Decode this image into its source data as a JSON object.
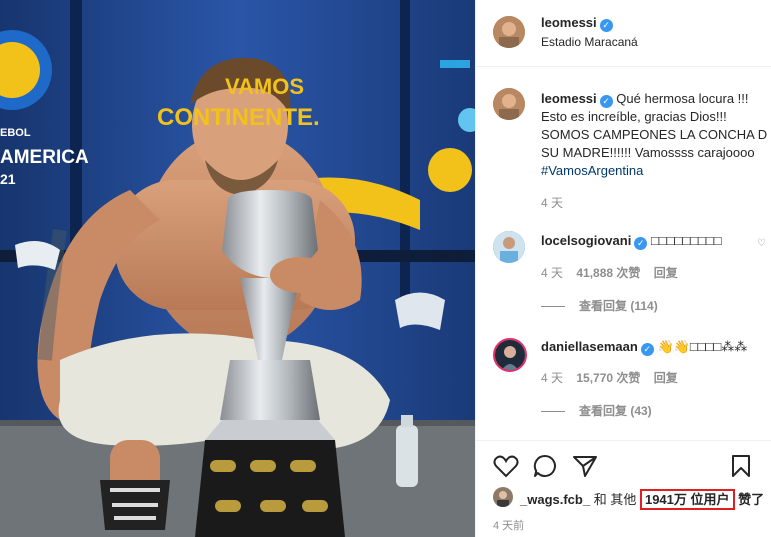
{
  "photo": {
    "banner_left_top": "EBOL",
    "banner_left_main": "AMERICA",
    "banner_left_year": "21",
    "banner_center_top": "VAMOS",
    "banner_center_main": "CONTINENTE."
  },
  "post_header": {
    "username": "leomessi",
    "verified_mark": "✓",
    "location": "Estadio Maracaná"
  },
  "caption": {
    "username": "leomessi",
    "line1": "Qué hermosa locura !!!",
    "line2": "Esto es increíble, gracias Dios!!!",
    "line3": "SOMOS CAMPEONES LA CONCHA D",
    "line4": "SU MADRE!!!!!! Vamossss carajoooo",
    "hashtag": "#VamosArgentina",
    "age": "4 天"
  },
  "comments": [
    {
      "username": "locelsogiovani",
      "text": "□□□□□□□□□",
      "age": "4 天",
      "likes": "41,888 次赞",
      "reply": "回复",
      "view_replies": "查看回复 (114)"
    },
    {
      "username": "daniellasemaan",
      "text": "👋👋□□□□⁂⁂",
      "age": "4 天",
      "likes": "15,770 次赞",
      "reply": "回复",
      "view_replies": "查看回复 (43)"
    }
  ],
  "likes_line": {
    "liker": "_wags.fcb_",
    "connector": "和 其他",
    "count": "1941万 位用户",
    "suffix": "赞了"
  },
  "post_age": "4 天前",
  "colors": {
    "verified": "#3897f0",
    "highlight": "#e02020",
    "hashtag": "#00376b"
  }
}
